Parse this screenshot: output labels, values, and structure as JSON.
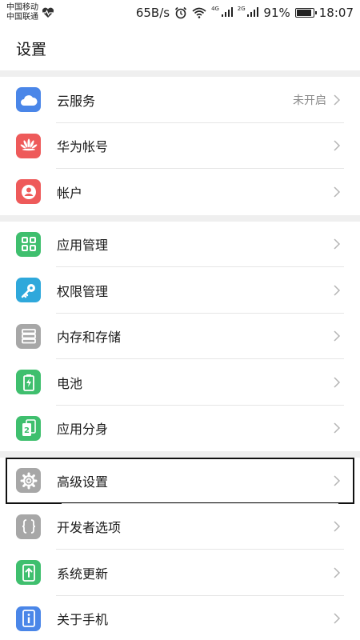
{
  "status_bar": {
    "carrier_1": "中国移动",
    "carrier_2": "中国联通",
    "net_speed": "65B/s",
    "sig1_label": "4G",
    "sig2_label": "2G",
    "battery_text": "91%",
    "battery_level": 0.91,
    "time": "18:07"
  },
  "header": {
    "title": "设置"
  },
  "groups": [
    {
      "items": [
        {
          "label": "云服务",
          "value": "未开启",
          "icon": "cloud-icon"
        },
        {
          "label": "华为帐号",
          "icon": "huawei-logo-icon"
        },
        {
          "label": "帐户",
          "icon": "person-icon"
        }
      ]
    },
    {
      "items": [
        {
          "label": "应用管理",
          "icon": "apps-grid-icon"
        },
        {
          "label": "权限管理",
          "icon": "key-icon"
        },
        {
          "label": "内存和存储",
          "icon": "storage-icon"
        },
        {
          "label": "电池",
          "icon": "battery-icon"
        },
        {
          "label": "应用分身",
          "icon": "app-twin-icon"
        }
      ]
    },
    {
      "items": [
        {
          "label": "高级设置",
          "icon": "gear-icon",
          "selected": true
        },
        {
          "label": "开发者选项",
          "icon": "braces-icon"
        },
        {
          "label": "系统更新",
          "icon": "update-arrow-icon"
        },
        {
          "label": "关于手机",
          "icon": "info-icon"
        }
      ]
    }
  ],
  "colors": {
    "accent_blue": "#4a86e8",
    "accent_red": "#ee5a5a",
    "accent_green": "#3fbf6e",
    "accent_cyan": "#2fa8db",
    "neutral_gray": "#a7a7a7"
  }
}
